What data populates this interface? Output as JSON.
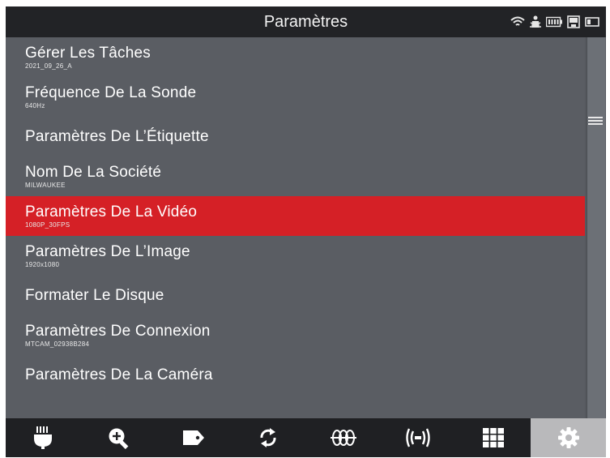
{
  "header": {
    "title": "Paramètres",
    "status_icons": [
      "wifi-icon",
      "bug-icon",
      "battery-icon",
      "storage-icon",
      "card-icon"
    ]
  },
  "menu": {
    "items": [
      {
        "label": "Gérer Les Tâches",
        "value": "2021_09_26_A"
      },
      {
        "label": "Fréquence De La Sonde",
        "value": "640Hz"
      },
      {
        "label": "Paramètres De L’Étiquette",
        "value": ""
      },
      {
        "label": "Nom De La Société",
        "value": "MILWAUKEE"
      },
      {
        "label": "Paramètres De La Vidéo",
        "value": "1080P_30FPS",
        "selected": true
      },
      {
        "label": "Paramètres De L’Image",
        "value": "1920x1080"
      },
      {
        "label": "Formater Le Disque",
        "value": ""
      },
      {
        "label": "Paramètres De Connexion",
        "value": "MTCAM_02938B284"
      },
      {
        "label": "Paramètres De La Caméra",
        "value": ""
      }
    ]
  },
  "toolbar": {
    "items": [
      "light-icon",
      "zoom-in-icon",
      "tag-icon",
      "rotate-icon",
      "sonde-icon",
      "transmitter-icon",
      "grid-icon",
      "gear-icon"
    ],
    "active": "gear-icon"
  },
  "colors": {
    "background": "#5a5d63",
    "titlebar": "#222326",
    "selected": "#d52026",
    "toolbar": "#1f2023",
    "toolbar_active": "#b9b9bb"
  }
}
